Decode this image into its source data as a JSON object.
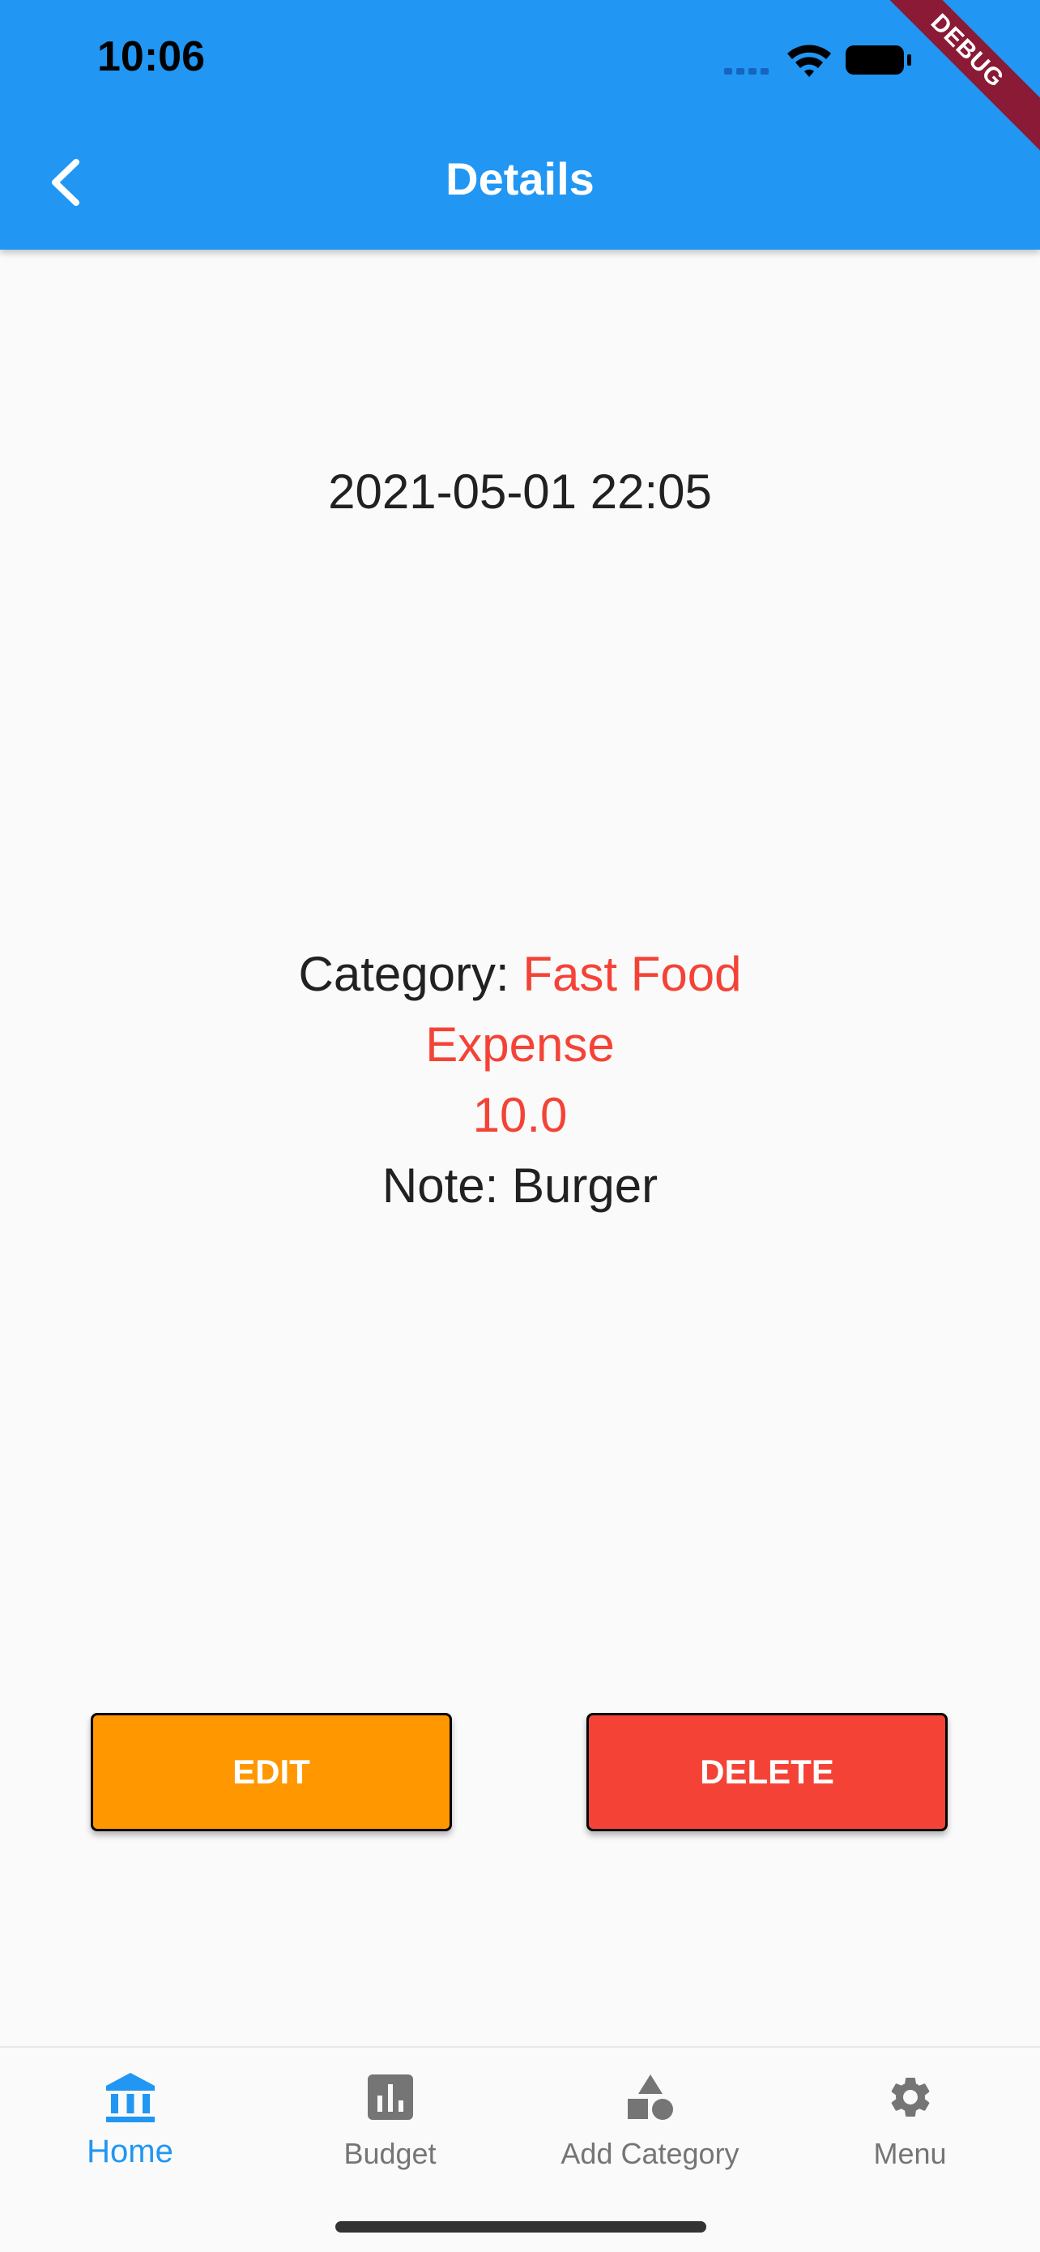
{
  "status_bar": {
    "time": "10:06"
  },
  "debug_banner": "DEBUG",
  "app_bar": {
    "title": "Details",
    "back_icon": "chevron-left-icon"
  },
  "transaction": {
    "datetime": "2021-05-01 22:05",
    "category_label": "Category: ",
    "category_value": "Fast Food",
    "type": "Expense",
    "amount": "10.0",
    "note_label": "Note: ",
    "note_value": "Burger"
  },
  "actions": {
    "edit_label": "EDIT",
    "delete_label": "DELETE"
  },
  "bottom_nav": {
    "items": [
      {
        "label": "Home",
        "icon": "bank-icon",
        "active": true
      },
      {
        "label": "Budget",
        "icon": "bar-chart-icon",
        "active": false
      },
      {
        "label": "Add Category",
        "icon": "shapes-icon",
        "active": false
      },
      {
        "label": "Menu",
        "icon": "gear-icon",
        "active": false
      }
    ]
  },
  "colors": {
    "primary": "#2196f3",
    "expense_red": "#f44336",
    "edit_orange": "#ff9800",
    "debug_banner": "#8a1a36"
  }
}
